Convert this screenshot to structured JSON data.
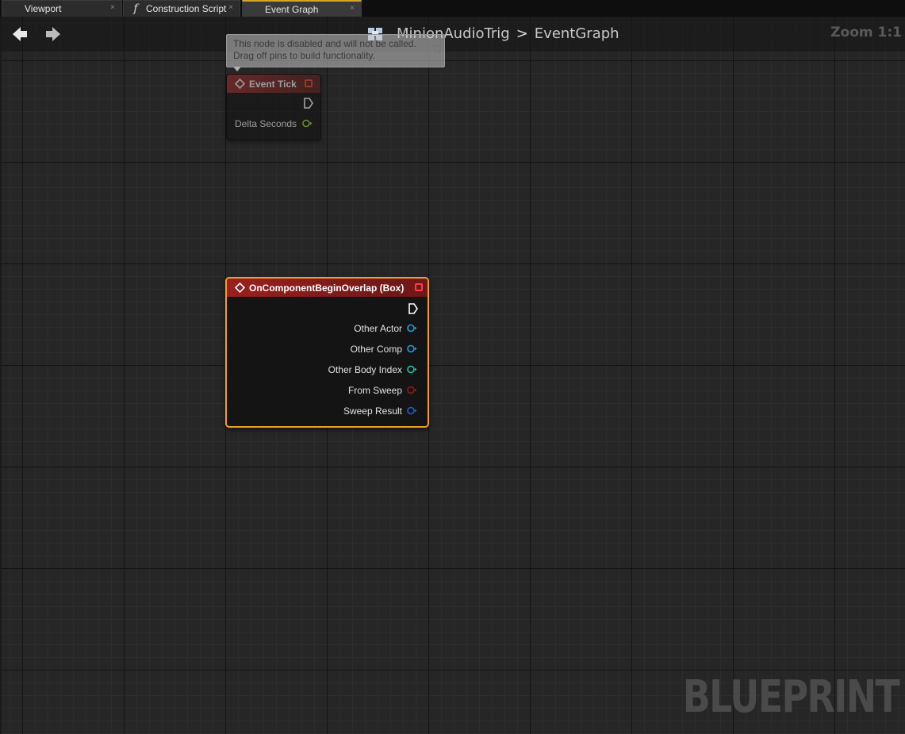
{
  "tabs": [
    {
      "label": "Viewport",
      "icon": "viewport-grid-icon",
      "close": "×"
    },
    {
      "label": "Construction Script",
      "icon": "function-icon",
      "close": "×"
    },
    {
      "label": "Event Graph",
      "icon": "event-graph-icon",
      "close": "×",
      "active": true
    }
  ],
  "header": {
    "breadcrumb_blueprint": "MinionAudioTrig",
    "breadcrumb_separator": ">",
    "breadcrumb_graph": "EventGraph",
    "zoom": "Zoom 1:1"
  },
  "tooltip": {
    "line1": "This node is disabled and will not be called.",
    "line2": "Drag off pins to build functionality."
  },
  "nodes": {
    "event_tick": {
      "title": "Event Tick",
      "pins": [
        "Delta Seconds"
      ],
      "disabled": true
    },
    "overlap": {
      "title": "OnComponentBeginOverlap (Box)",
      "pins": [
        "Other Actor",
        "Other Comp",
        "Other Body Index",
        "From Sweep",
        "Sweep Result"
      ],
      "selected": true
    }
  },
  "colors": {
    "accent_selection": "#f0a020",
    "event_header": "#9b1f1f",
    "pin_object": "#1fa0e6",
    "pin_int": "#20c8a0",
    "pin_bool": "#8c0f0f",
    "pin_struct": "#1f5fd8",
    "pin_float": "#8ed040"
  },
  "watermark": "BLUEPRINT"
}
